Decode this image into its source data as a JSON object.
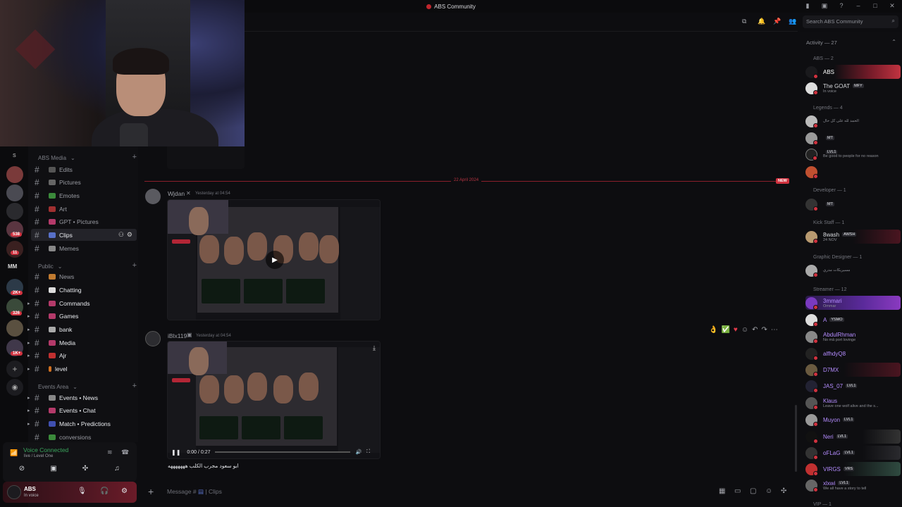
{
  "window": {
    "title": "ABS Community"
  },
  "header": {
    "search_placeholder": "Search ABS Community"
  },
  "server_rail": {
    "top_initial": "S",
    "mid_initial": "MM",
    "badges": [
      "538",
      "11",
      "2K+",
      "326",
      "1K+"
    ]
  },
  "categories": [
    {
      "label": "ABS Media"
    },
    {
      "label": "Public"
    },
    {
      "label": "Events Area"
    }
  ],
  "channels": [
    {
      "label": "Edits"
    },
    {
      "label": "Pictures"
    },
    {
      "label": "Emotes"
    },
    {
      "label": "Art"
    },
    {
      "label": "GPT • Pictures"
    },
    {
      "label": "Clips"
    },
    {
      "label": "Memes"
    },
    {
      "label": "News"
    },
    {
      "label": "Chatting"
    },
    {
      "label": "Commands"
    },
    {
      "label": "Games"
    },
    {
      "label": "bank"
    },
    {
      "label": "Media"
    },
    {
      "label": "Ajr"
    },
    {
      "label": "level"
    },
    {
      "label": "Events • News"
    },
    {
      "label": "Events • Chat"
    },
    {
      "label": "Match • Predictions"
    },
    {
      "label": "conversions"
    }
  ],
  "voice": {
    "status": "Voice Connected",
    "detail": "live / Level One"
  },
  "user": {
    "name": "ABS",
    "status": "In voice"
  },
  "chat": {
    "date_divider": "22 April 2024",
    "new_badge": "NEW",
    "messages": [
      {
        "author": "Wjdan",
        "time": "Yesterday at 04:54"
      },
      {
        "author": "iBlx119",
        "time": "Yesterday at 04:54",
        "video_time": "0:00 / 0:27",
        "text": "ابو سعود مجرب الكلب هههههههه"
      }
    ],
    "composer_placeholder": "Message #",
    "composer_channel": "Clips"
  },
  "members": {
    "activity_header": "Activity — 27",
    "groups": [
      {
        "label": "ABS — 2"
      },
      {
        "label": "Legends — 4"
      },
      {
        "label": "Developer — 1"
      },
      {
        "label": "Kick Staff — 1"
      },
      {
        "label": "Graphic Designer — 1"
      },
      {
        "label": "Streamer — 12"
      },
      {
        "label": "VIP — 1"
      }
    ],
    "list": [
      {
        "name": "ABS",
        "status": ""
      },
      {
        "name": "The GOAT",
        "tag": "MFY",
        "status": "In voice"
      },
      {
        "name": "",
        "status": "الحمد لله على كل حال"
      },
      {
        "name": "",
        "tag": "MT",
        "status": ""
      },
      {
        "name": "",
        "tag": "LVL1",
        "status": "Be good to people for no reason"
      },
      {
        "name": "",
        "status": ""
      },
      {
        "name": "",
        "tag": "MT",
        "status": ""
      },
      {
        "name": "8wash",
        "tag": "AWSH",
        "status": "24 NOV"
      },
      {
        "name": "",
        "status": "مسيريكات مدري"
      },
      {
        "name": "3mmari",
        "status": "Ommar"
      },
      {
        "name": "A",
        "tag": "YSMO",
        "status": ""
      },
      {
        "name": "AbdulRhman",
        "status": "No mā port lovinge"
      },
      {
        "name": "alfhdyQ8",
        "status": ""
      },
      {
        "name": "D7MX",
        "status": ""
      },
      {
        "name": "JAS_07",
        "tag": "LVL1",
        "status": ""
      },
      {
        "name": "Klaus",
        "status": "Leave one wolf alive and the s..."
      },
      {
        "name": "Muyon",
        "tag": "LVL1",
        "status": ""
      },
      {
        "name": "Neri",
        "tag": "LVL1",
        "status": ""
      },
      {
        "name": "oFLaG",
        "tag": "LVL1",
        "status": ""
      },
      {
        "name": "VIRGS",
        "tag": "VRS",
        "status": ""
      },
      {
        "name": "xlxwi",
        "tag": "LVL1",
        "status": "We all have a story to tell"
      }
    ]
  }
}
